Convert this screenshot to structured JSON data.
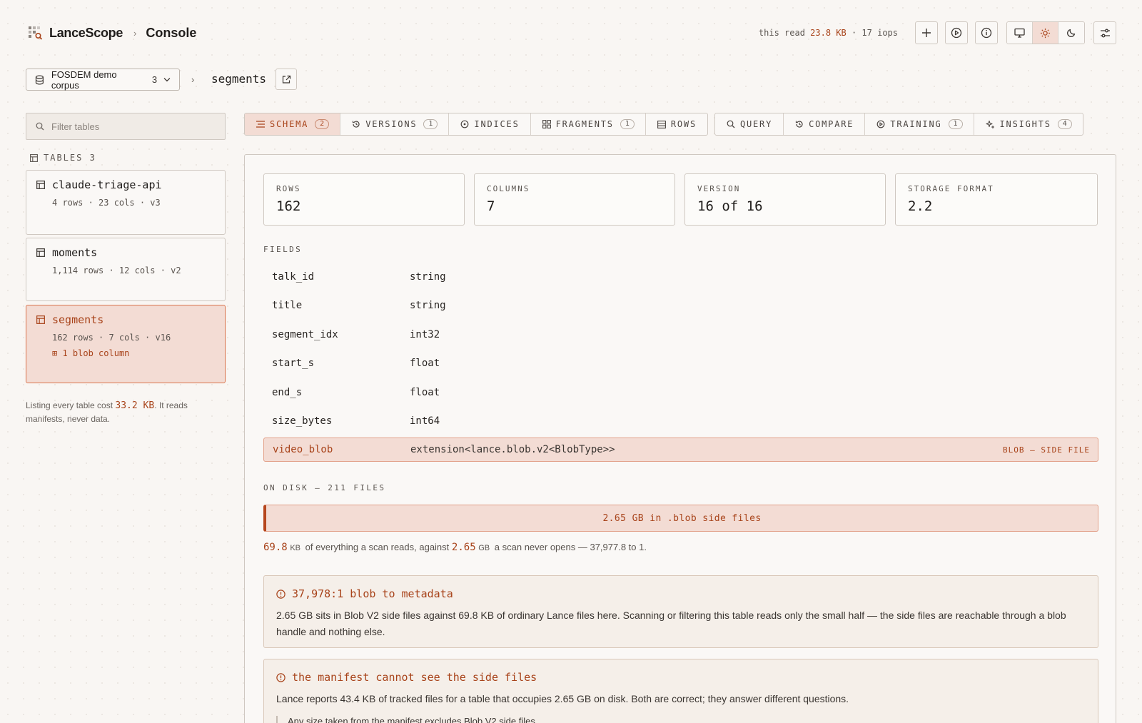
{
  "header": {
    "brand": "LanceScope",
    "crumb": "Console",
    "read_prefix": "this read",
    "read_bytes": "23.8 KB",
    "read_iops": "· 17 iops"
  },
  "selector": {
    "corpus_label": "FOSDEM demo corpus",
    "corpus_count": "3",
    "table_name": "segments"
  },
  "sidebar": {
    "filter_placeholder": "Filter tables",
    "tables_heading": "TABLES 3",
    "tables": [
      {
        "name": "claude-triage-api",
        "meta": "4 rows · 23 cols · v3"
      },
      {
        "name": "moments",
        "meta": "1,114 rows · 12 cols · v2"
      },
      {
        "name": "segments",
        "meta": "162 rows · 7 cols · v16",
        "blob": "1 blob column"
      }
    ],
    "note_prefix": "Listing every table cost",
    "note_value": "33.2 KB",
    "note_suffix": ". It reads manifests, never data."
  },
  "tabs": [
    {
      "label": "SCHEMA",
      "badge": "2",
      "icon": "list-icon"
    },
    {
      "label": "VERSIONS",
      "badge": "1",
      "icon": "history-icon"
    },
    {
      "label": "INDICES",
      "badge": "",
      "icon": "target-icon"
    },
    {
      "label": "FRAGMENTS",
      "badge": "1",
      "icon": "grid-icon"
    },
    {
      "label": "ROWS",
      "badge": "",
      "icon": "rows-icon"
    },
    {
      "label": "QUERY",
      "badge": "",
      "icon": "search-icon"
    },
    {
      "label": "COMPARE",
      "badge": "",
      "icon": "history-icon"
    },
    {
      "label": "TRAINING",
      "badge": "1",
      "icon": "play-icon"
    },
    {
      "label": "INSIGHTS",
      "badge": "4",
      "icon": "sparkle-icon"
    }
  ],
  "stats": [
    {
      "label": "ROWS",
      "value": "162"
    },
    {
      "label": "COLUMNS",
      "value": "7"
    },
    {
      "label": "VERSION",
      "value": "16 of 16"
    },
    {
      "label": "STORAGE FORMAT",
      "value": "2.2"
    }
  ],
  "fields_heading": "FIELDS",
  "fields": [
    {
      "name": "talk_id",
      "type": "string"
    },
    {
      "name": "title",
      "type": "string"
    },
    {
      "name": "segment_idx",
      "type": "int32"
    },
    {
      "name": "start_s",
      "type": "float"
    },
    {
      "name": "end_s",
      "type": "float"
    },
    {
      "name": "size_bytes",
      "type": "int64"
    },
    {
      "name": "video_blob",
      "type": "extension<lance.blob.v2<BlobType>>",
      "tag": "BLOB — SIDE FILE"
    }
  ],
  "disk": {
    "heading": "ON DISK — 211 FILES",
    "bar_text": "2.65 GB in .blob side files",
    "scan_value": "69.8",
    "scan_unit": "KB",
    "mid_text": "of everything a scan reads, against",
    "blob_value": "2.65",
    "blob_unit": "GB",
    "tail_text": "a scan never opens — 37,977.8 to 1."
  },
  "insights": [
    {
      "title": "37,978:1 blob to metadata",
      "body": "2.65 GB sits in Blob V2 side files against 69.8 KB of ordinary Lance files here. Scanning or filtering this table reads only the small half — the side files are reachable through a blob handle and nothing else."
    },
    {
      "title": "the manifest cannot see the side files",
      "body": "Lance reports 43.4 KB of tracked files for a table that occupies 2.65 GB on disk. Both are correct; they answer different questions.",
      "quote": "Any size taken from the manifest excludes Blob V2 side files."
    }
  ],
  "colors": {
    "accent": "#a8431a",
    "accent_bg": "#f3dcd4",
    "border": "#cfc8c1",
    "page_bg": "#f9f6f3"
  }
}
